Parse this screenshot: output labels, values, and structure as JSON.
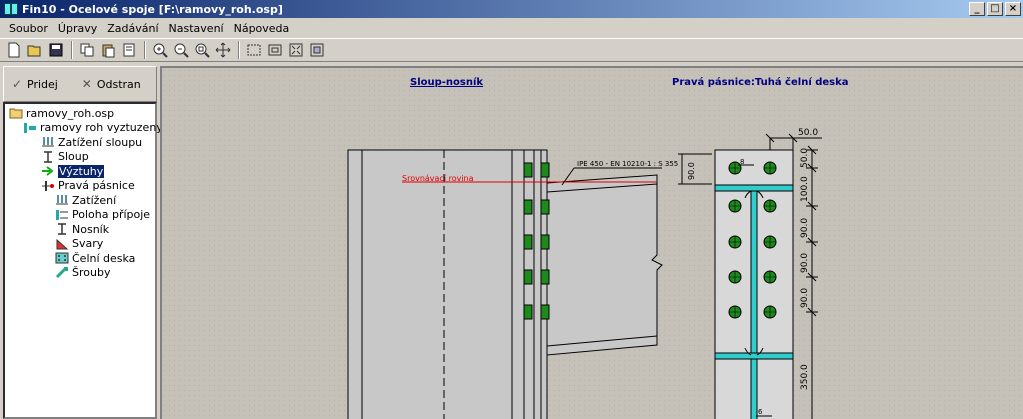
{
  "window": {
    "title": "Fin10 - Ocelové spoje [F:\\ramovy_roh.osp]",
    "buttons": {
      "minimize": "_",
      "maximize": "□",
      "close": "×"
    }
  },
  "menu": [
    "Soubor",
    "Úpravy",
    "Zadávání",
    "Nastavení",
    "Nápoveda"
  ],
  "toolbar": {
    "icons": [
      "new-file-icon",
      "open-file-icon",
      "save-icon",
      "copy-icon",
      "paste-icon",
      "properties-icon",
      "zoom-in-icon",
      "zoom-out-icon",
      "zoom-window-icon",
      "pan-icon",
      "view-frame-icon",
      "view-normal-icon",
      "zoom-extents-icon",
      "fit-icon"
    ]
  },
  "panel": {
    "add_label": "Pridej",
    "remove_label": "Odstran"
  },
  "tree": {
    "root": "ramovy_roh.osp",
    "project": "ramovy roh vyztuzeny",
    "items": [
      {
        "label": "Zatížení sloupu",
        "level": 2
      },
      {
        "label": "Sloup",
        "level": 2
      },
      {
        "label": "Výztuhy",
        "level": 2,
        "selected": true
      },
      {
        "label": "Pravá pásnice",
        "level": 2
      },
      {
        "label": "Zatížení",
        "level": 3
      },
      {
        "label": "Poloha přípoje",
        "level": 3
      },
      {
        "label": "Nosník",
        "level": 3
      },
      {
        "label": "Svary",
        "level": 3
      },
      {
        "label": "Čelní deska",
        "level": 3
      },
      {
        "label": "Šrouby",
        "level": 3
      }
    ]
  },
  "drawing": {
    "heading_left": "Sloup-nosník",
    "heading_right": "Pravá pásnice:Tuhá čelní deska",
    "beam_label": "IPE 450 - EN 10210-1 : S 355",
    "reference_plane": "Srovnávací rovina",
    "dim_top": "50.0",
    "dim_left": "90.0",
    "weld_mark": "8",
    "weld_mark_bottom": "6",
    "dims_right": [
      "50.0",
      "100.0",
      "90.0",
      "90.0",
      "90.0",
      "350.0"
    ],
    "colors": {
      "bolt": "#1e8a1e",
      "stiffener": "#33cccc",
      "section": "#c8c8c8",
      "reference": "#e00000"
    }
  }
}
